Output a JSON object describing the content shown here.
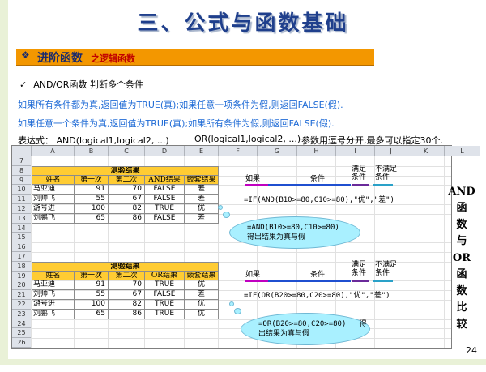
{
  "title": "三、公式与函数基础",
  "section": {
    "bullet": "❖",
    "title": "进阶函数",
    "subtitle": "之逻辑函数"
  },
  "check": {
    "tick": "✓",
    "text": "AND/OR函数  判断多个条件"
  },
  "line_and": "如果所有条件都为真,返回值为TRUE(真);如果任意一项条件为假,则返回FALSE(假).",
  "line_or": "如果任意一个条件为真,返回值为TRUE(真);如果所有条件为假,则返回FALSE(假).",
  "syntax": {
    "and": "表达式：  AND(logical1,logical2, ...)",
    "or": "OR(logical1,logical2, ...)",
    "note": "参数用逗号分开,最多可以指定30个."
  },
  "sheet": {
    "columns": [
      "A",
      "B",
      "C",
      "D",
      "E",
      "F",
      "G",
      "H",
      "I",
      "J",
      "K",
      "L"
    ],
    "rows": [
      "7",
      "8",
      "9",
      "10",
      "11",
      "12",
      "13",
      "14",
      "15",
      "16",
      "17",
      "18",
      "19",
      "20",
      "21",
      "22",
      "23",
      "24",
      "25",
      "26"
    ],
    "table1": {
      "title": "测验结果",
      "headers": [
        "姓名",
        "第一次",
        "第二次",
        "AND结果",
        "嵌套结果"
      ],
      "rows": [
        [
          "马亚迪",
          "91",
          "70",
          "FALSE",
          "差"
        ],
        [
          "刘帅飞",
          "55",
          "67",
          "FALSE",
          "差"
        ],
        [
          "游号进",
          "100",
          "82",
          "TRUE",
          "优"
        ],
        [
          "刘鹏飞",
          "65",
          "86",
          "FALSE",
          "差"
        ]
      ]
    },
    "table2": {
      "title": "测验结果",
      "headers": [
        "姓名",
        "第一次",
        "第二次",
        "OR结果",
        "嵌套结果"
      ],
      "rows": [
        [
          "马亚迪",
          "91",
          "70",
          "TRUE",
          "优"
        ],
        [
          "刘帅飞",
          "55",
          "67",
          "FALSE",
          "差"
        ],
        [
          "游号进",
          "100",
          "82",
          "TRUE",
          "优"
        ],
        [
          "刘鹏飞",
          "65",
          "86",
          "TRUE",
          "优"
        ]
      ]
    },
    "annot1": {
      "label_if": "如果",
      "label_cond": "条件",
      "label_sat": "满足\n条件",
      "label_unsat": "不满足\n条件",
      "formula": "=IF(AND(B10>=80,C10>=80),\"优\",\"差\")",
      "cloud": "=AND(B10>=80,C10>=80)\n得出结果为真与假"
    },
    "annot2": {
      "label_if": "如果",
      "label_cond": "条件",
      "label_sat": "满足\n条件",
      "label_unsat": "不满足\n条件",
      "formula": "=IF(OR(B20>=80,C20>=80),\"优\",\"差\")",
      "cloud": "=OR(B20>=80,C20>=80)   得\n出结果为真与假"
    },
    "side_text": [
      "AND",
      "函",
      "数",
      "与",
      "OR",
      "函",
      "数",
      "比",
      "较"
    ]
  },
  "page_number": "24",
  "colors": {
    "title": "#1f3f8c",
    "section_bar": "#f39700",
    "blue_text": "#1f6bd6",
    "header_fill": "#ffcc33",
    "cloud": "#a9f0ff"
  }
}
